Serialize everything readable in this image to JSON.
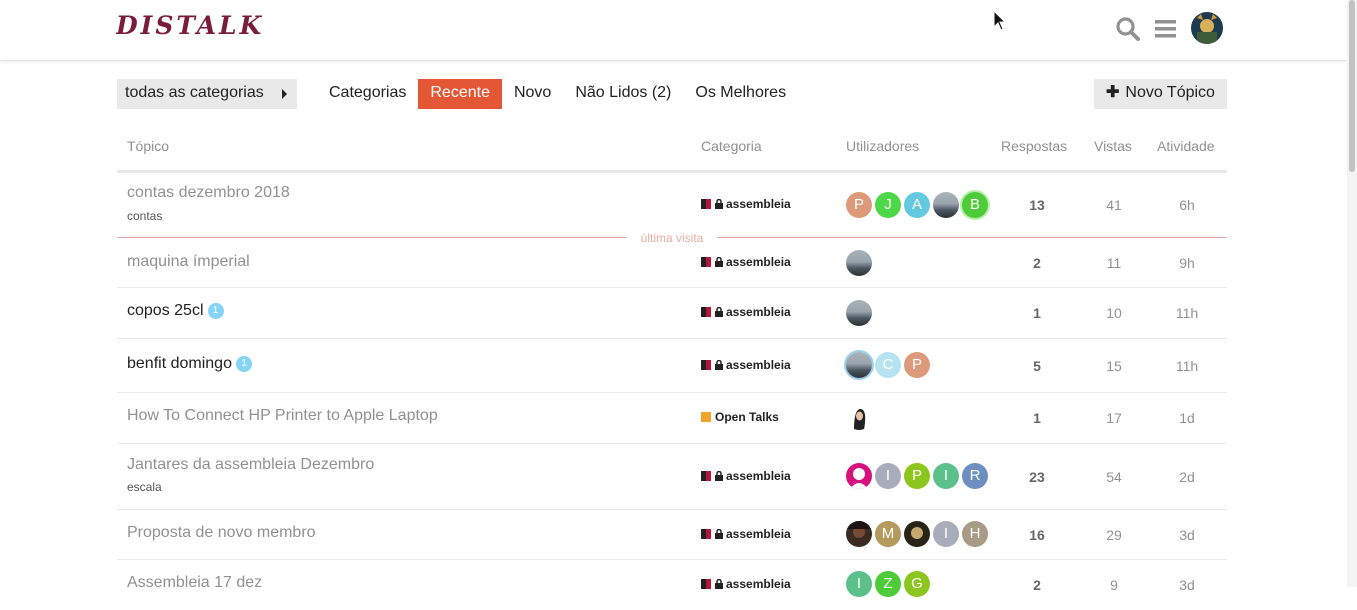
{
  "header": {
    "logo_text": "DISTALK",
    "icons": [
      "search-icon",
      "hamburger-menu-icon",
      "user-avatar"
    ]
  },
  "nav": {
    "category_dropdown": "todas as categorias",
    "tabs": [
      "Categorias",
      "Recente",
      "Novo",
      "Não Lidos (2)",
      "Os Melhores"
    ],
    "active_tab": "Recente",
    "new_topic": "Novo Tópico"
  },
  "table": {
    "headers": {
      "topic": "Tópico",
      "category": "Categoria",
      "users": "Utilizadores",
      "replies": "Respostas",
      "views": "Vistas",
      "activity": "Atividade"
    },
    "last_visit_label": "última visita",
    "rows": [
      {
        "title": "contas dezembro 2018",
        "tag": "contas",
        "category": "assembleia",
        "users": [
          "P",
          "J",
          "A",
          "photo",
          "B"
        ],
        "replies": "13",
        "views": "41",
        "activity": "6h"
      },
      {
        "title": "maquina ímperial",
        "category": "assembleia",
        "users": [
          "photo"
        ],
        "replies": "2",
        "views": "11",
        "activity": "9h"
      },
      {
        "title": "copos 25cl",
        "unread_count": "1",
        "category": "assembleia",
        "users": [
          "photo"
        ],
        "replies": "1",
        "views": "10",
        "activity": "11h"
      },
      {
        "title": "benfit domingo",
        "unread_count": "1",
        "category": "assembleia",
        "users": [
          "photo",
          "C",
          "P"
        ],
        "replies": "5",
        "views": "15",
        "activity": "11h"
      },
      {
        "title": "How To Connect HP Printer to Apple Laptop",
        "category": "Open Talks",
        "users": [
          "photo"
        ],
        "replies": "1",
        "views": "17",
        "activity": "1d"
      },
      {
        "title": "Jantares da assembleia Dezembro",
        "tag": "escala",
        "category": "assembleia",
        "users": [
          "photo",
          "I",
          "P",
          "I",
          "R"
        ],
        "replies": "23",
        "views": "54",
        "activity": "2d"
      },
      {
        "title": "Proposta de novo membro",
        "category": "assembleia",
        "users": [
          "photo",
          "M",
          "photo",
          "I",
          "H"
        ],
        "replies": "16",
        "views": "29",
        "activity": "3d"
      },
      {
        "title": "Assembleia 17 dez",
        "category": "assembleia",
        "users": [
          "I",
          "Z",
          "G"
        ],
        "replies": "2",
        "views": "9",
        "activity": "3d"
      }
    ]
  },
  "colors": {
    "accent": "#e45735",
    "assembleia_category": "#b3163a",
    "open_talks_category": "#f1a32a",
    "unread_badge": "#85d4f3"
  }
}
